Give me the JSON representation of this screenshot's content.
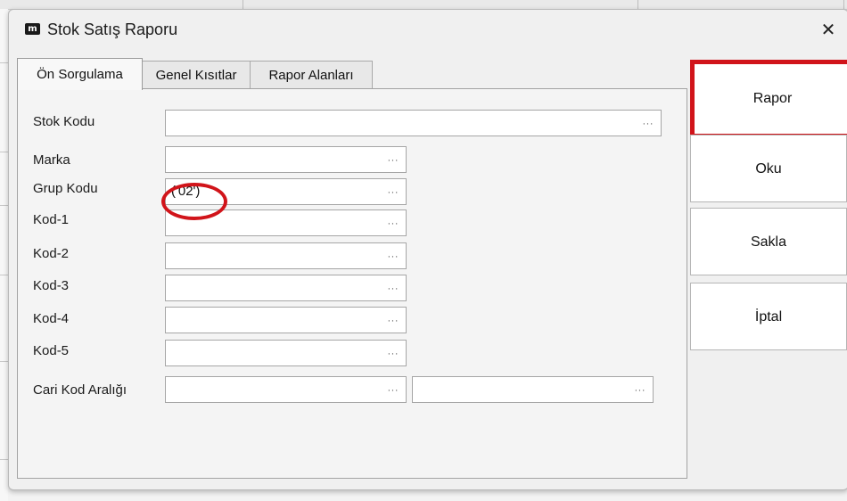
{
  "window": {
    "title": "Stok Satış Raporu",
    "app_icon_text": "m",
    "close_glyph": "✕"
  },
  "tabs": [
    {
      "label": "Ön Sorgulama",
      "active": true
    },
    {
      "label": "Genel Kısıtlar",
      "active": false
    },
    {
      "label": "Rapor Alanları",
      "active": false
    }
  ],
  "fields": {
    "stok_kodu": {
      "label": "Stok Kodu",
      "value": ""
    },
    "marka": {
      "label": "Marka",
      "value": ""
    },
    "grup_kodu": {
      "label": "Grup Kodu",
      "value": "('02')"
    },
    "kod1": {
      "label": "Kod-1",
      "value": ""
    },
    "kod2": {
      "label": "Kod-2",
      "value": ""
    },
    "kod3": {
      "label": "Kod-3",
      "value": ""
    },
    "kod4": {
      "label": "Kod-4",
      "value": ""
    },
    "kod5": {
      "label": "Kod-5",
      "value": ""
    },
    "cari_kod_araligi": {
      "label": "Cari Kod Aralığı",
      "value_start": "",
      "value_end": ""
    }
  },
  "ellipsis": "···",
  "buttons": {
    "rapor": "Rapor",
    "oku": "Oku",
    "sakla": "Sakla",
    "iptal": "İptal"
  },
  "colors": {
    "highlight": "#d1141a"
  }
}
